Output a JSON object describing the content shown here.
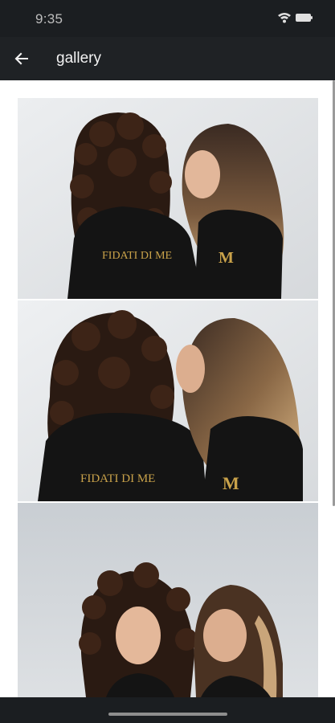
{
  "status_bar": {
    "time": "9:35",
    "icons": [
      "wifi-icon",
      "battery-icon"
    ]
  },
  "app_bar": {
    "title": "gallery",
    "back_icon": "arrow-left-icon"
  },
  "gallery": {
    "photos": [
      {
        "alt": "",
        "logo_text": "FIDATI DI ME",
        "logo_mark": "M"
      },
      {
        "alt": "",
        "logo_text": "FIDATI DI ME",
        "logo_mark": "M"
      },
      {
        "alt": "",
        "logo_text": "",
        "logo_mark": ""
      }
    ]
  },
  "colors": {
    "bar_bg": "#1f2225",
    "gold": "#c9a24a",
    "shirt": "#141414"
  }
}
